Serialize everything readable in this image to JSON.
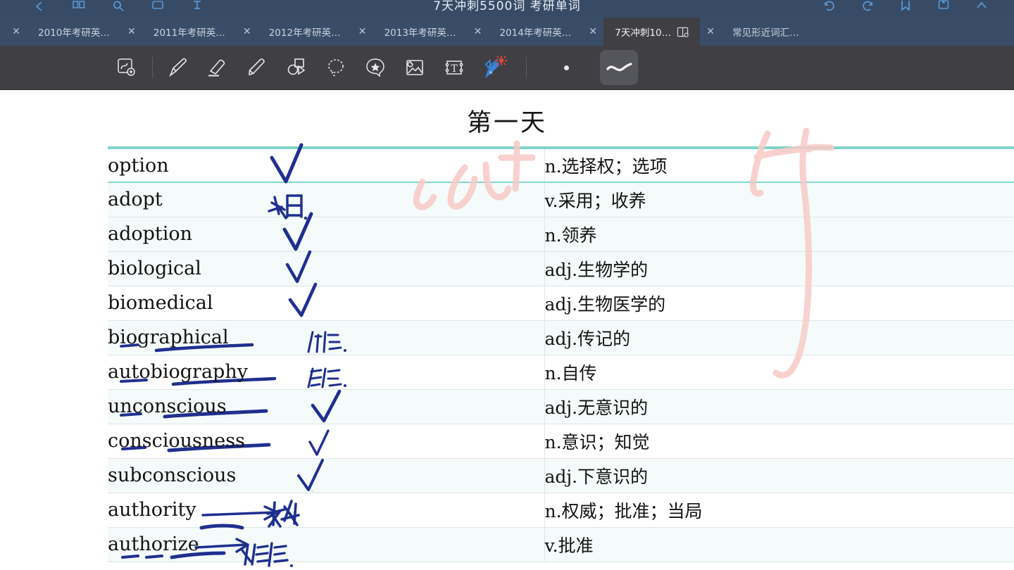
{
  "window": {
    "title": "7天冲刺5500词 考研单词",
    "left_icons": [
      "back-arrow-icon",
      "grid-view-icon",
      "search-icon",
      "rectangle-icon",
      "text-tool-icon"
    ],
    "right_icons": [
      "undo-icon",
      "redo-icon",
      "bookmark-icon",
      "page-icon",
      "collapse-icon"
    ]
  },
  "tabs": {
    "items": [
      {
        "label": "",
        "partial": true,
        "active": false,
        "badge": ""
      },
      {
        "label": "2010年考研英…",
        "partial": false,
        "active": false,
        "badge": ""
      },
      {
        "label": "2011年考研英…",
        "partial": false,
        "active": false,
        "badge": ""
      },
      {
        "label": "2012年考研英…",
        "partial": false,
        "active": false,
        "badge": ""
      },
      {
        "label": "2013年考研英…",
        "partial": false,
        "active": false,
        "badge": ""
      },
      {
        "label": "2014年考研英…",
        "partial": false,
        "active": false,
        "badge": ""
      },
      {
        "label": "7天冲刺10…",
        "partial": false,
        "active": true,
        "badge": "book-icon"
      },
      {
        "label": "常见形近词汇…",
        "partial": false,
        "active": false,
        "badge": ""
      }
    ],
    "close_glyph": "✕"
  },
  "toolbar": {
    "items": [
      {
        "name": "snip-zoom-tool",
        "label": "选区放大"
      },
      {
        "name": "pen-tool",
        "label": "钢笔"
      },
      {
        "name": "eraser-tool",
        "label": "橡皮擦"
      },
      {
        "name": "highlighter-tool",
        "label": "荧光笔"
      },
      {
        "name": "shapes-tool",
        "label": "形状"
      },
      {
        "name": "lasso-tool",
        "label": "套索"
      },
      {
        "name": "sticker-tool",
        "label": "贴纸"
      },
      {
        "name": "image-tool",
        "label": "图片"
      },
      {
        "name": "text-tool",
        "label": "文本"
      },
      {
        "name": "bluetooth-pen-tool",
        "label": "蓝牙笔"
      }
    ],
    "color_dot": "#e8e8e8",
    "stroke_preview_label": "笔迹粗细"
  },
  "document": {
    "title": "第一天",
    "table": {
      "rows": [
        {
          "word": "option",
          "def": "n.选择权；选项",
          "mark": "check-large",
          "shade": "plain"
        },
        {
          "word": "adopt",
          "def": "v.采用；收养",
          "mark": "note-caiyong",
          "shade": "alt"
        },
        {
          "word": "adoption",
          "def": "n.领养",
          "mark": "check-large",
          "shade": "alt"
        },
        {
          "word": "biological",
          "def": "adj.生物学的",
          "mark": "check-small",
          "shade": "alt"
        },
        {
          "word": "biomedical",
          "def": "adj.生物医学的",
          "mark": "check-small",
          "shade": "plain"
        },
        {
          "word": "biographical",
          "def": "adj.传记的",
          "mark": "note-zhuanji",
          "shade": "alt"
        },
        {
          "word": "autobiography",
          "def": "n.自传",
          "mark": "note-zizhuan",
          "shade": "plain"
        },
        {
          "word": "unconscious",
          "def": "adj.无意识的",
          "mark": "check-small",
          "shade": "alt"
        },
        {
          "word": "consciousness",
          "def": "n.意识；知觉",
          "mark": "check-tiny",
          "shade": "plain"
        },
        {
          "word": "subconscious",
          "def": "adj.下意识的",
          "mark": "check-small",
          "shade": "alt"
        },
        {
          "word": "authority",
          "def": "n.权威；批准；当局",
          "mark": "note-quanwei",
          "shade": "plain"
        },
        {
          "word": "authorize",
          "def": "v.批准",
          "mark": "note-pizhun",
          "shade": "alt"
        }
      ]
    },
    "ink": {
      "blue_color": "#1f2f8f",
      "pink_color": "#f6c9c6"
    }
  }
}
